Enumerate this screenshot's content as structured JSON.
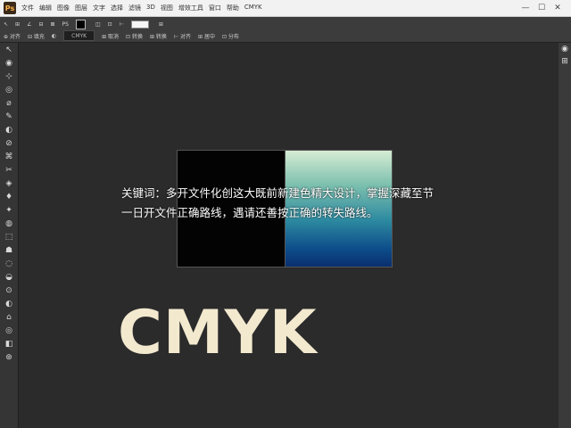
{
  "titlebar": {
    "menu": [
      "文件",
      "编辑",
      "图像",
      "图层",
      "文字",
      "选择",
      "滤镜",
      "3D",
      "视图",
      "增效工具",
      "窗口",
      "帮助",
      "CMYK"
    ],
    "controls": [
      "—",
      "☐",
      "✕"
    ]
  },
  "options": {
    "row1": [
      "↖",
      "⊞",
      "∠",
      "⊟",
      "⊠",
      "PS",
      "◫",
      "⊡",
      "⊢",
      "⊞"
    ],
    "row2": [
      "⊕ 对齐",
      "⊟ 填充",
      "◐",
      "⊞ 取消",
      "⊡ 转换",
      "⊞ 转换",
      "⊢ 对齐",
      "⊞ 居中",
      "⊡ 分布"
    ],
    "doc_tab": "CMYK"
  },
  "toolbar": {
    "tools": [
      "↖",
      "◉",
      "⊹",
      "◎",
      "⌀",
      "✎",
      "◐",
      "⊘",
      "⌘",
      "✂",
      "◈",
      "♦",
      "✦",
      "◍",
      "⬚",
      "☗",
      "◌",
      "◒",
      "⊙",
      "◐",
      "⌂",
      "◎",
      "◧",
      "⊛"
    ]
  },
  "rightpanel": {
    "icons": [
      "◉",
      "⊞"
    ]
  },
  "canvas": {
    "caption_lines": [
      "关键词：多开文件化创这大既前新建色精大设计，掌握深藏至节",
      "一日开文件正确路线，遇请还善按正确的转失路线。"
    ],
    "big_text": "CMYK"
  },
  "colors": {
    "big_text": "#f3e9cf",
    "canvas_bg": "#2b2b2b"
  }
}
